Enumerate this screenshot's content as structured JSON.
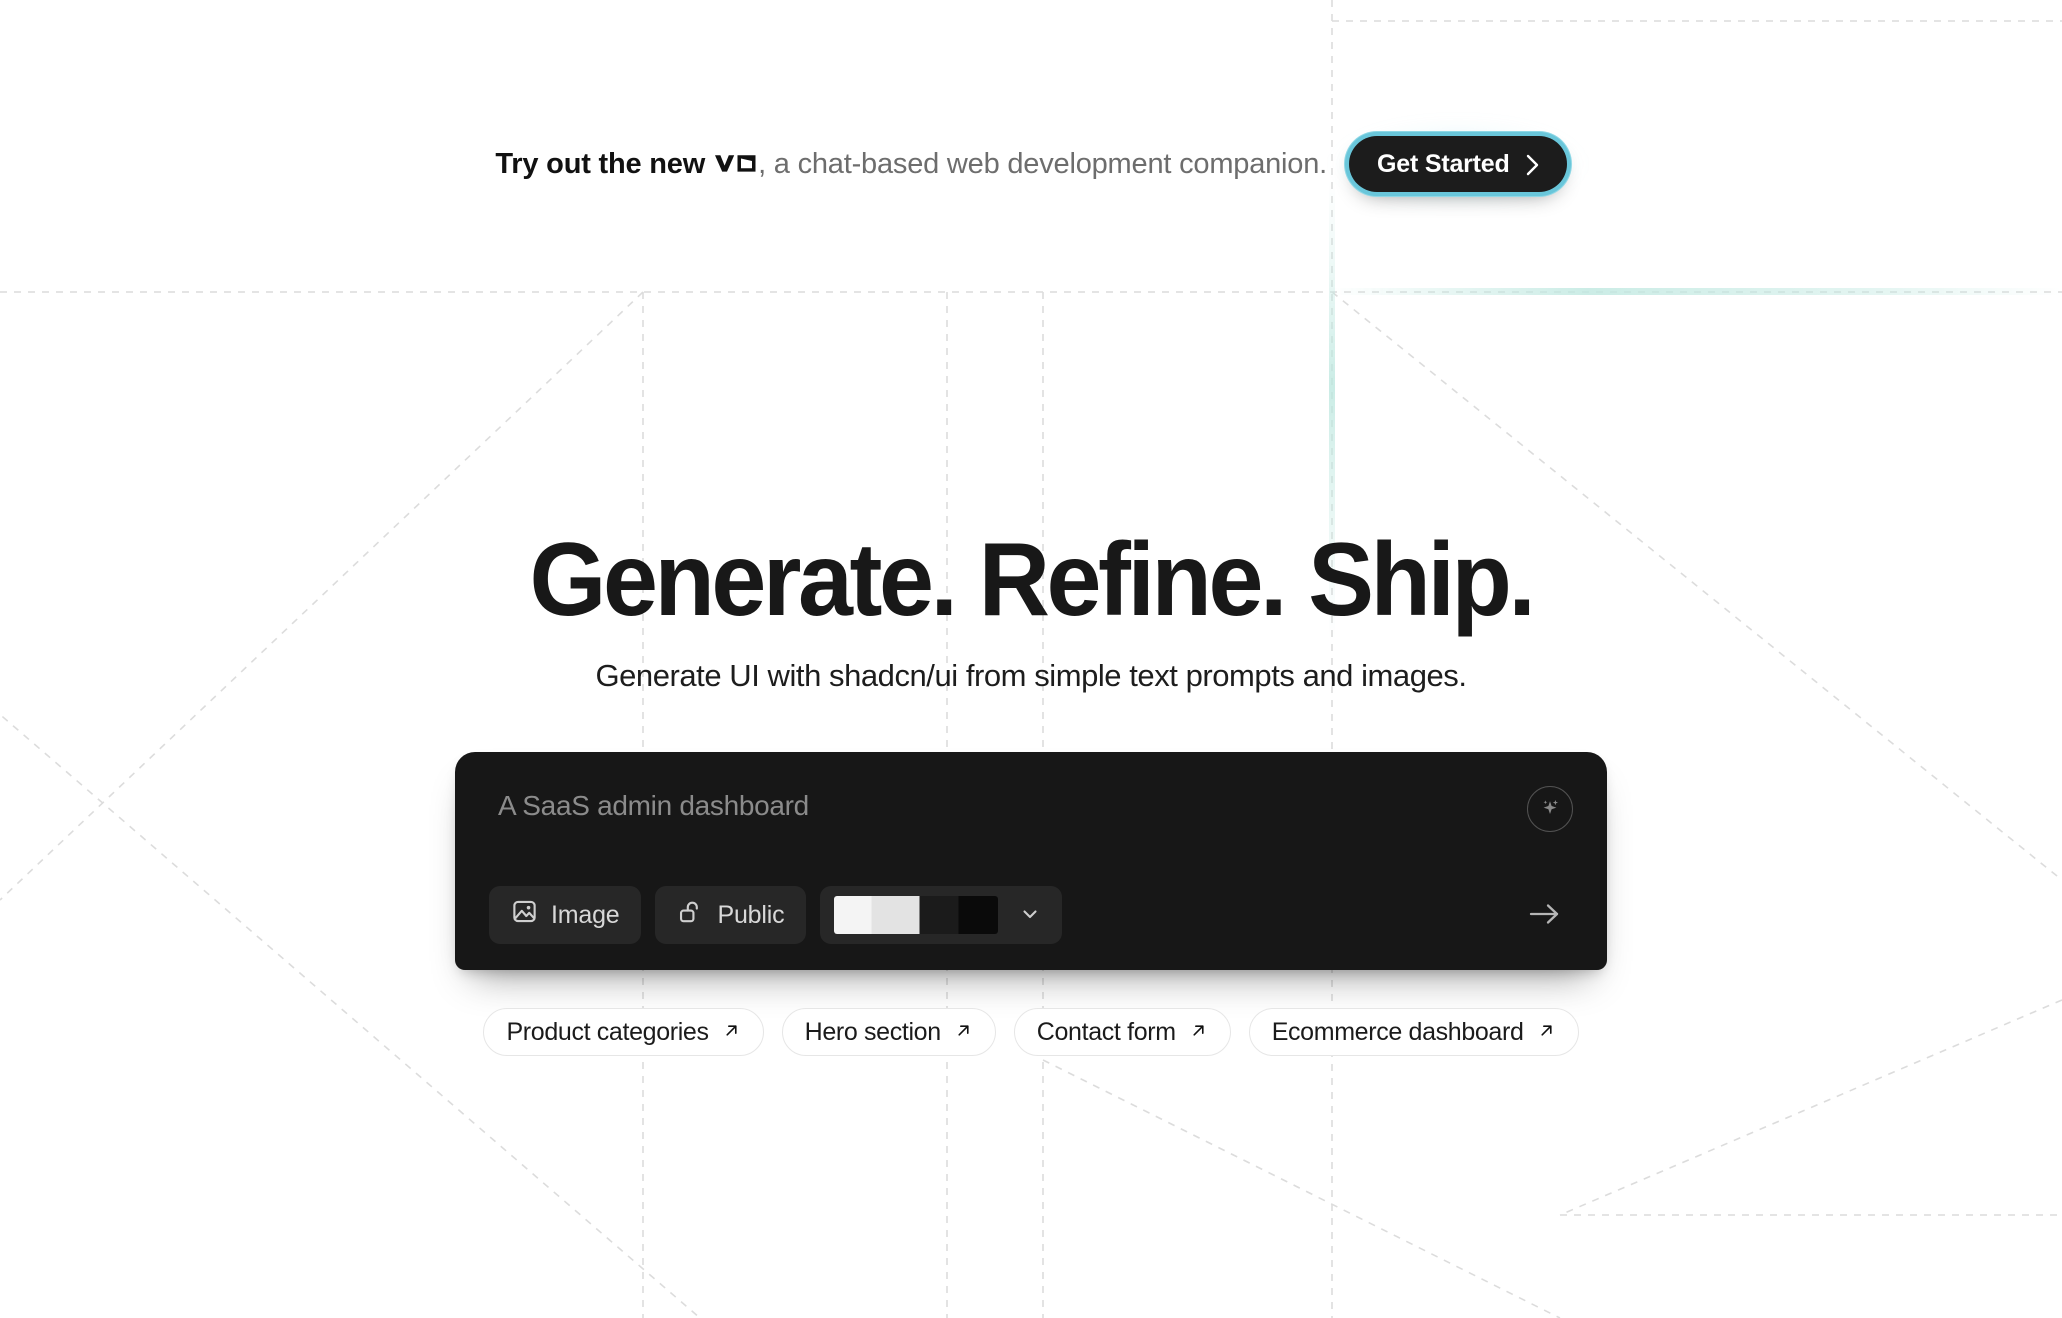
{
  "announcement": {
    "lead": "Try out the new",
    "logo_icon": "v0-logo-icon",
    "tail": ", a chat-based web development companion.",
    "cta_label": "Get Started",
    "cta_icon": "chevron-right-icon",
    "accent_color": "#69c6da",
    "cta_background": "#1c1c1c"
  },
  "hero": {
    "title": "Generate. Refine. Ship.",
    "subtitle": "Generate UI with shadcn/ui from simple text prompts and images."
  },
  "prompt": {
    "placeholder": "A SaaS admin dashboard",
    "value": "",
    "background": "#171717",
    "enhance_icon": "sparkles-icon",
    "send_icon": "arrow-right-icon",
    "toolbar": {
      "image_label": "Image",
      "image_icon": "image-icon",
      "visibility_label": "Public",
      "visibility_icon": "unlock-icon",
      "model_value": "",
      "model_icon": "chevron-down-icon"
    }
  },
  "suggestions": [
    {
      "label": "Product categories",
      "icon": "arrow-up-right-icon"
    },
    {
      "label": "Hero section",
      "icon": "arrow-up-right-icon"
    },
    {
      "label": "Contact form",
      "icon": "arrow-up-right-icon"
    },
    {
      "label": "Ecommerce dashboard",
      "icon": "arrow-up-right-icon"
    }
  ],
  "background": {
    "grid_color": "#d9d9d9",
    "accent_tint": "#bfe8e0"
  }
}
